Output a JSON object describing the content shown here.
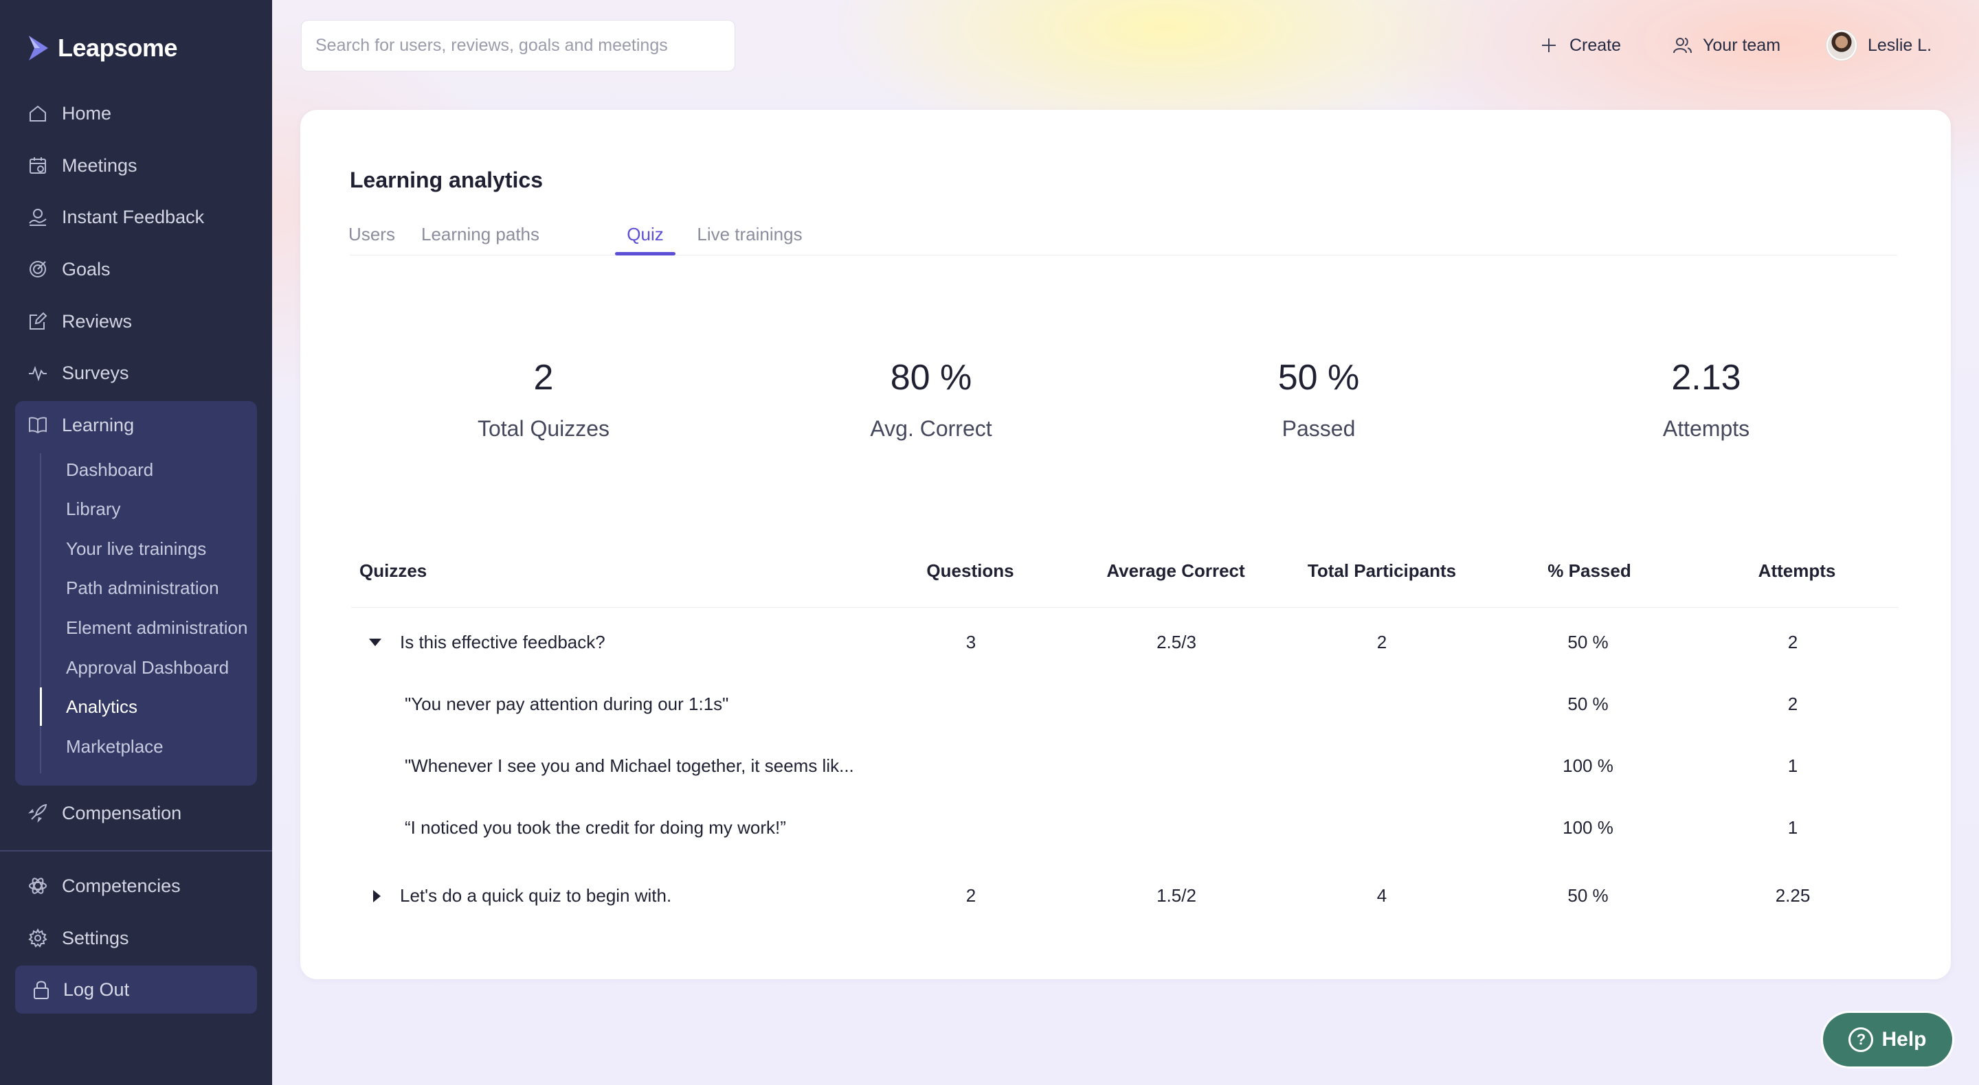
{
  "app": {
    "brand": "Leapsome"
  },
  "sidebar": {
    "items": [
      {
        "label": "Home",
        "icon": "home-icon"
      },
      {
        "label": "Meetings",
        "icon": "calendar-icon"
      },
      {
        "label": "Instant Feedback",
        "icon": "feedback-icon"
      },
      {
        "label": "Goals",
        "icon": "target-icon"
      },
      {
        "label": "Reviews",
        "icon": "edit-icon"
      },
      {
        "label": "Surveys",
        "icon": "pulse-icon"
      },
      {
        "label": "Learning",
        "icon": "book-icon"
      },
      {
        "label": "Compensation",
        "icon": "rocket-icon"
      },
      {
        "label": "Competencies",
        "icon": "atom-icon"
      },
      {
        "label": "Settings",
        "icon": "gear-icon"
      }
    ],
    "learning_sub": [
      "Dashboard",
      "Library",
      "Your live trainings",
      "Path administration",
      "Element administration",
      "Approval Dashboard",
      "Analytics",
      "Marketplace"
    ],
    "active_sub": "Analytics",
    "logout_label": "Log Out"
  },
  "topbar": {
    "search_placeholder": "Search for users, reviews, goals and meetings",
    "create_label": "Create",
    "team_label": "Your team",
    "user_name": "Leslie L."
  },
  "main": {
    "title": "Learning analytics",
    "tabs": [
      "Users",
      "Learning paths",
      "Quiz",
      "Live trainings"
    ],
    "active_tab": "Quiz",
    "stats": [
      {
        "value": "2",
        "label": "Total Quizzes"
      },
      {
        "value": "80 %",
        "label": "Avg. Correct"
      },
      {
        "value": "50 %",
        "label": "Passed"
      },
      {
        "value": "2.13",
        "label": "Attempts"
      }
    ],
    "table": {
      "headers": [
        "Quizzes",
        "Questions",
        "Average Correct",
        "Total Participants",
        "% Passed",
        "Attempts"
      ],
      "rows": [
        {
          "name": "Is this effective feedback?",
          "questions": "3",
          "avg": "2.5/3",
          "participants": "2",
          "passed": "50 %",
          "attempts": "2",
          "expanded": true
        },
        {
          "name": "\"You never pay attention during our 1:1s\"",
          "passed": "50 %",
          "attempts": "2"
        },
        {
          "name": "\"Whenever I see you and Michael together, it seems lik...",
          "passed": "100 %",
          "attempts": "1"
        },
        {
          "name": "“I noticed you took the credit for doing my work!”",
          "passed": "100 %",
          "attempts": "1"
        },
        {
          "name": "Let's do a quick quiz to begin with.",
          "questions": "2",
          "avg": "1.5/2",
          "participants": "4",
          "passed": "50 %",
          "attempts": "2.25",
          "expanded": false
        }
      ]
    }
  },
  "help": {
    "label": "Help"
  },
  "colors": {
    "sidebar": "#262a43",
    "accent": "#5b4fd6",
    "help": "#3e7a6a"
  }
}
